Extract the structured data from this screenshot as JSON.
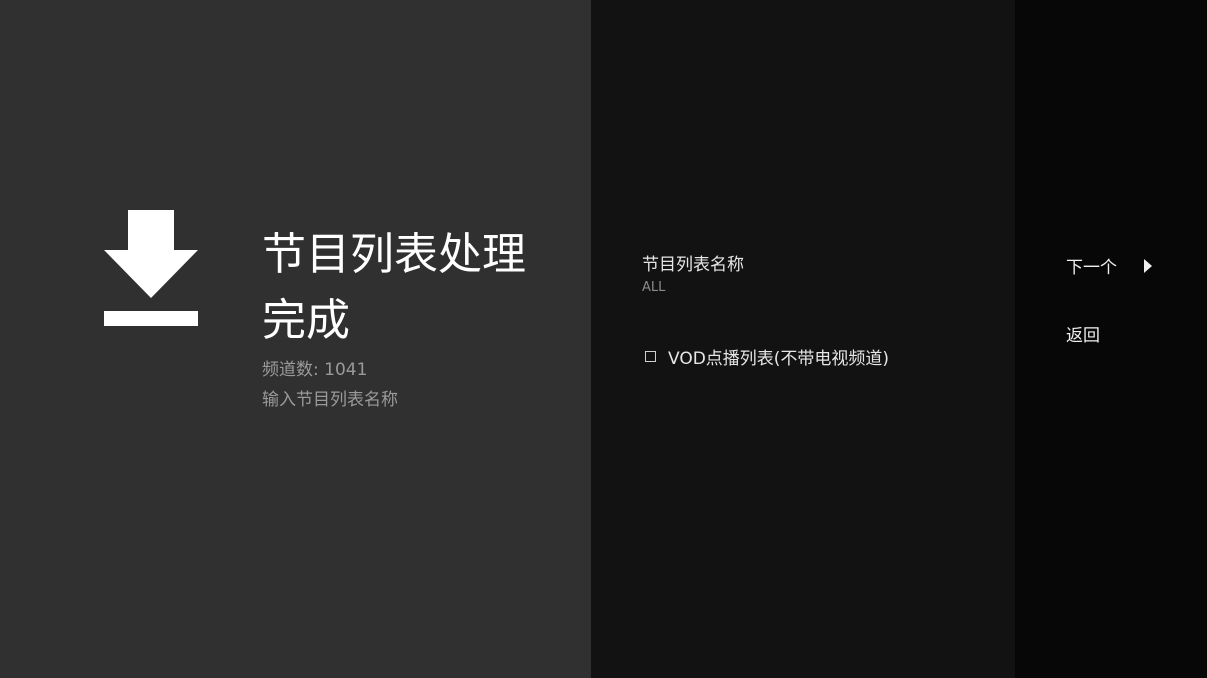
{
  "left_panel": {
    "title": "节目列表处理完成",
    "channel_count": "频道数: 1041",
    "subtitle": "输入节目列表名称",
    "icon": "download-icon"
  },
  "form": {
    "name_label": "节目列表名称",
    "name_value": "ALL",
    "vod_option_label": "VOD点播列表(不带电视频道)",
    "vod_checked": false
  },
  "actions": {
    "next_label": "下一个",
    "next_icon": "play-arrow-icon",
    "back_label": "返回"
  },
  "colors": {
    "left_bg": "#303030",
    "middle_bg": "#121212",
    "right_bg": "#070707",
    "primary_text": "#ffffff",
    "secondary_text": "#9a9a9a"
  }
}
